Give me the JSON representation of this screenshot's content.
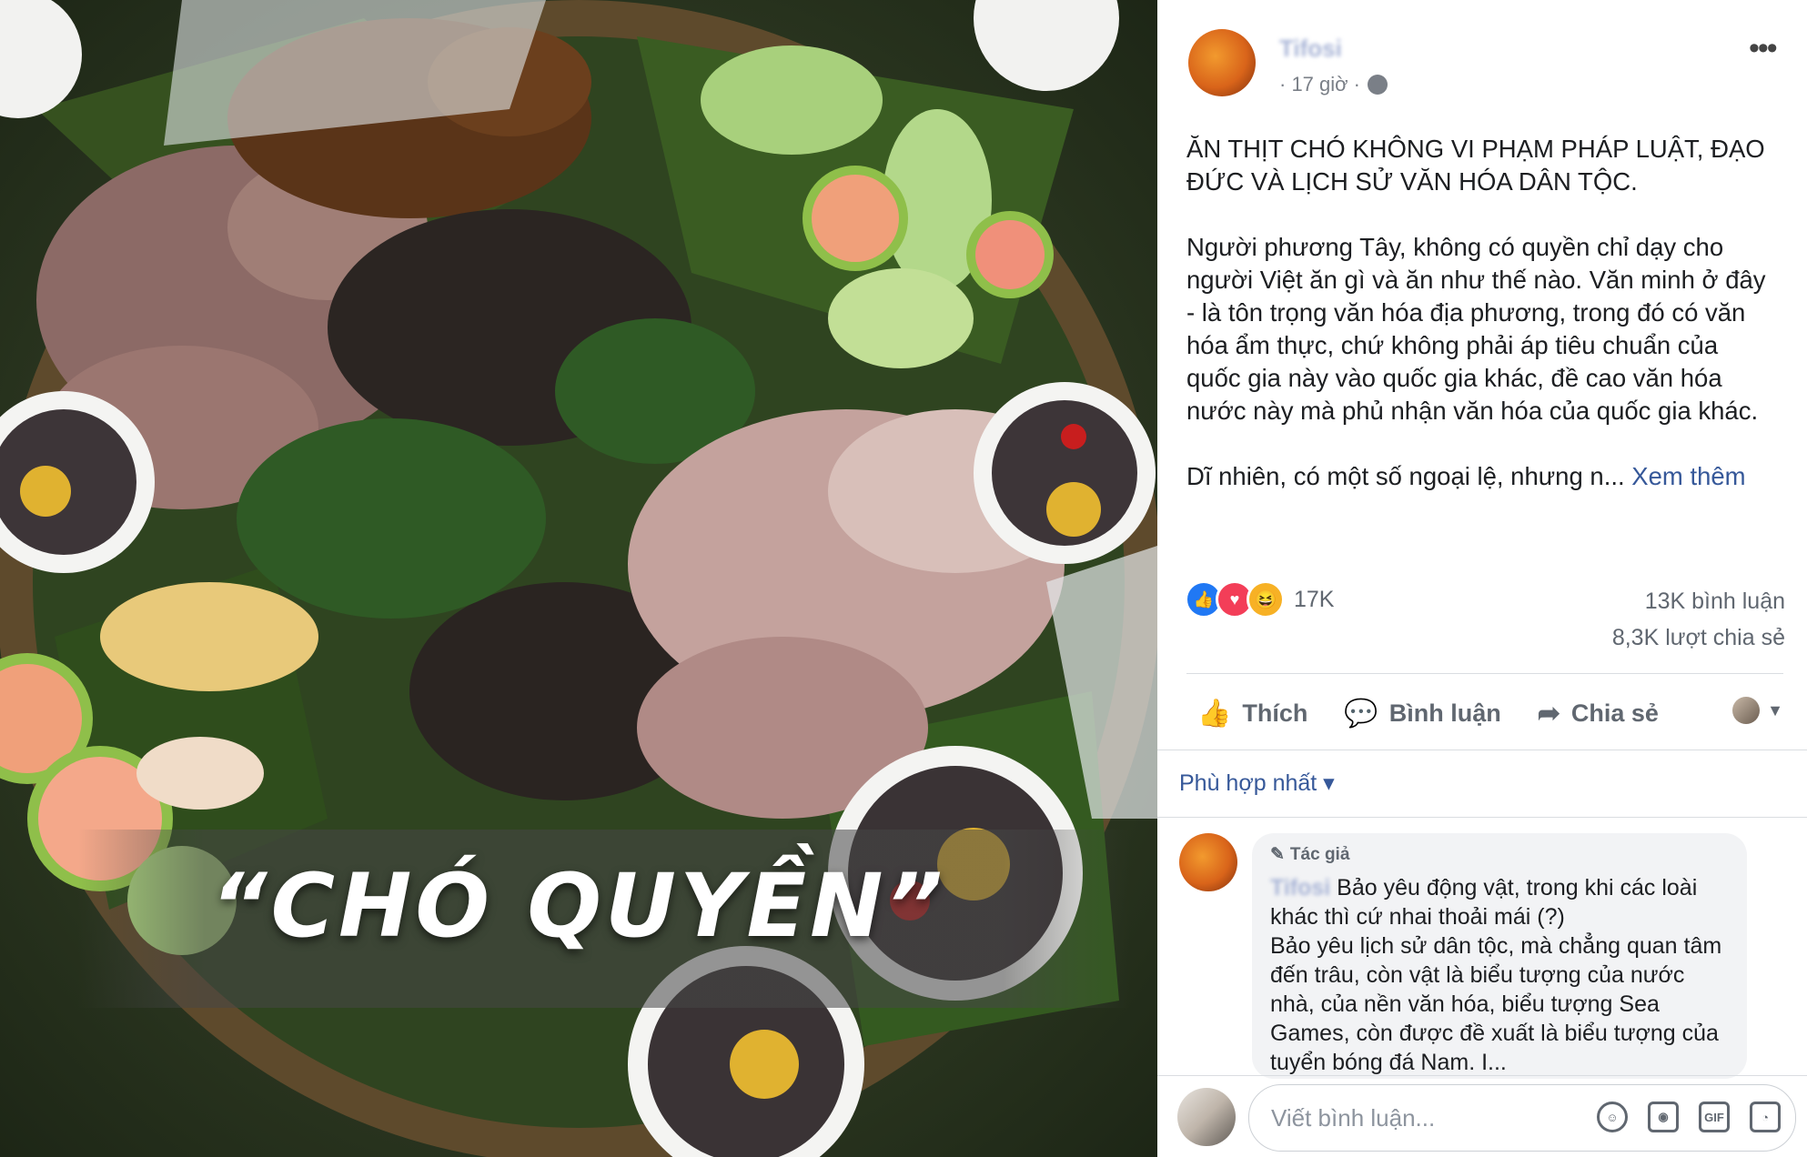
{
  "photo": {
    "overlay_text": "“CHÓ QUYỀN”"
  },
  "post": {
    "author_name": "Tifosi",
    "time": "· 17 giờ ·",
    "paragraphs": [
      "ĂN THỊT CHÓ KHÔNG VI PHẠM PHÁP LUẬT, ĐẠO ĐỨC VÀ LỊCH SỬ VĂN HÓA DÂN TỘC.",
      "Người phương Tây, không có quyền chỉ dạy cho người Việt ăn gì và ăn như thế nào. Văn minh ở đây - là tôn trọng văn hóa địa phương, trong đó có văn hóa ẩm thực, chứ không phải áp tiêu chuẩn của quốc gia này vào quốc gia khác, đề cao văn hóa nước này mà phủ nhận văn hóa của quốc gia khác."
    ],
    "last_paragraph": "Dĩ nhiên, có một số ngoại lệ, nhưng n...",
    "see_more": "Xem thêm",
    "more_icon": "•••"
  },
  "reactions": {
    "count": "17K",
    "comments": "13K bình luận",
    "shares": "8,3K lượt chia sẻ",
    "icons": [
      "like-icon",
      "love-icon",
      "haha-icon"
    ]
  },
  "actions": {
    "like": "Thích",
    "comment": "Bình luận",
    "share": "Chia sẻ"
  },
  "comments": {
    "sort_label": "Phù hợp nhất ▾",
    "items": [
      {
        "badge": "Tác giả",
        "name": "Tifosi",
        "text_after_name": " Bảo yêu động vật, trong khi các loài",
        "text_rest": "khác thì cứ nhai thoải mái (?)\nBảo yêu lịch sử dân tộc, mà chẳng quan tâm đến trâu, còn vật là biểu tượng của nước nhà, của nền văn hóa, biểu tượng Sea Games, còn được đề xuất là biểu tượng của tuyển bóng đá Nam. I..."
      }
    ],
    "input_placeholder": "Viết bình luận..."
  },
  "colors": {
    "link": "#365899",
    "like": "#2078f4",
    "love": "#f33e58",
    "haha": "#f7b125"
  }
}
